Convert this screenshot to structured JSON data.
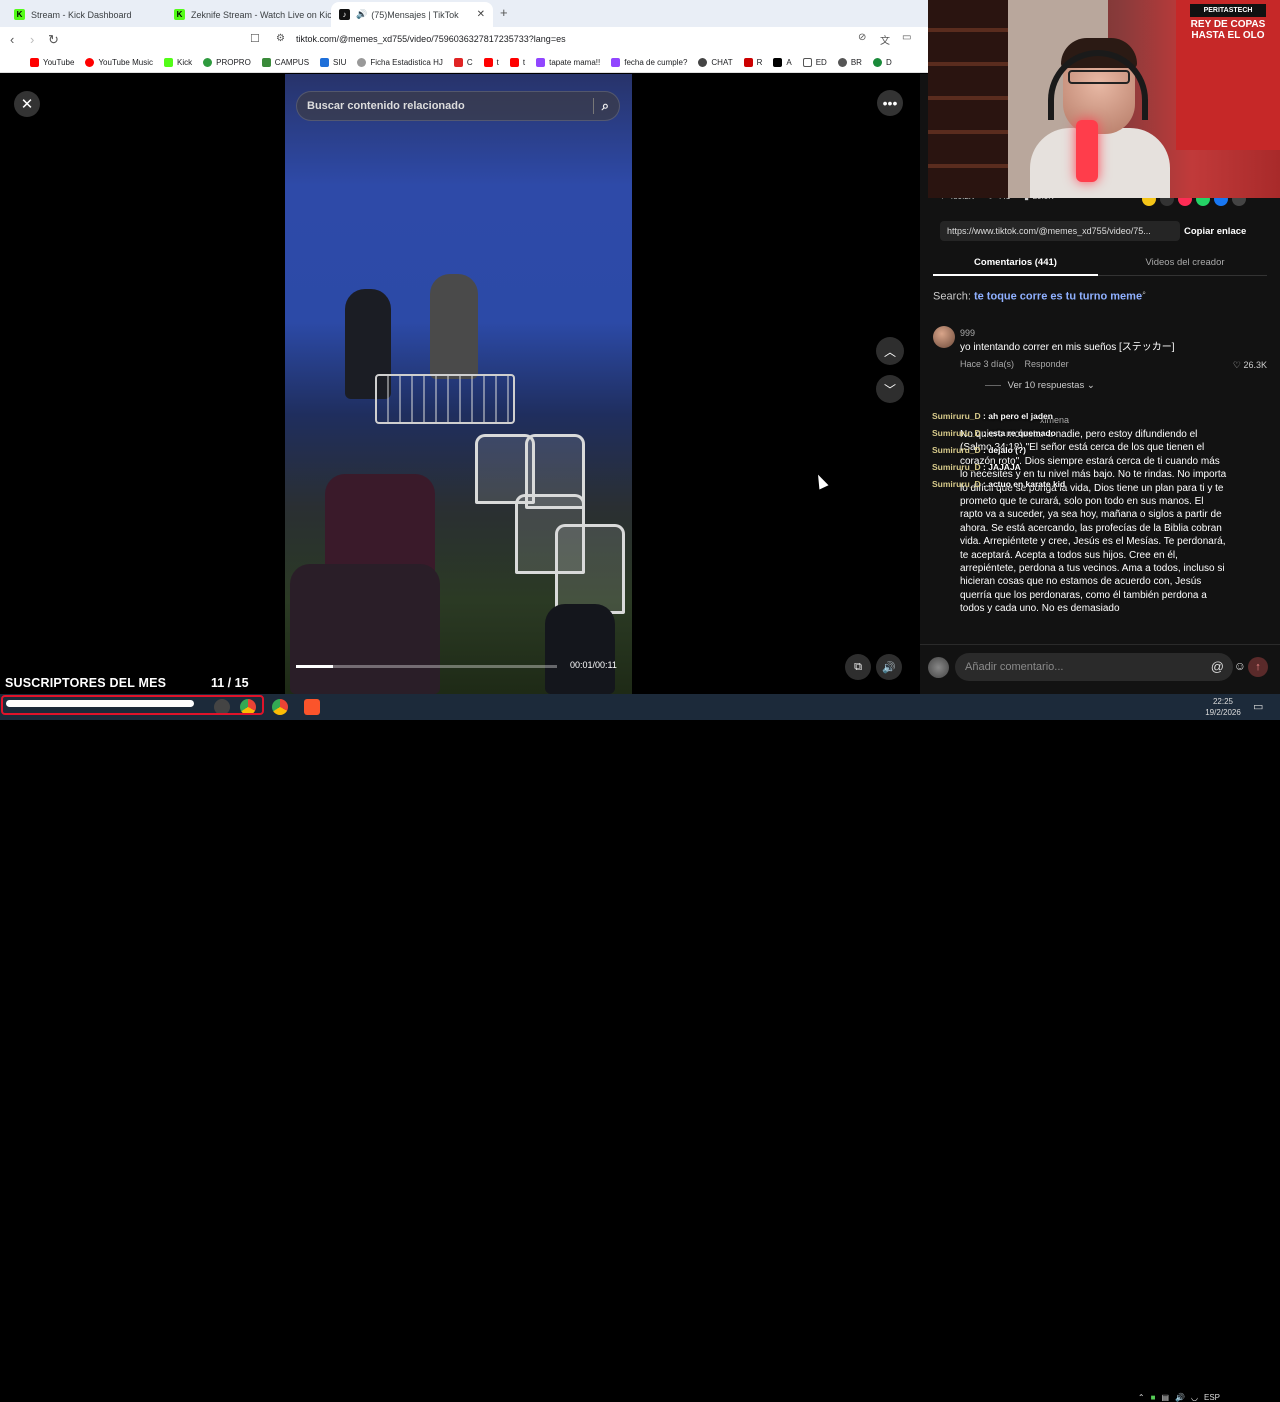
{
  "browser": {
    "tabs": [
      {
        "label": "Stream - Kick Dashboard",
        "icon": "kick-icon"
      },
      {
        "label": "Zeknife Stream - Watch Live on Kick",
        "icon": "kick-icon"
      },
      {
        "label": "(75)Mensajes | TikTok",
        "icon": "tiktok-icon",
        "active": true
      }
    ],
    "url": "tiktok.com/@memes_xd755/video/7596036327817235733?lang=es",
    "bookmarks": [
      "YouTube",
      "YouTube Music",
      "Kick",
      "PROPRO",
      "CAMPUS",
      "SIU",
      "Ficha Estadistica HJ",
      "C",
      "t",
      "t",
      "tapate mama!!",
      "fecha de cumple?",
      "CHAT",
      "R",
      "A",
      "ED",
      "BR",
      "D"
    ]
  },
  "player": {
    "search_placeholder": "Buscar contenido relacionado",
    "time": "00:01/00:11",
    "progress_fraction": 0.14
  },
  "overlay": {
    "subs_title": "SUSCRIPTORES DEL MES",
    "subs_count": "11  / 15"
  },
  "panel": {
    "stats": [
      "480.2K",
      "441",
      "29.9K"
    ],
    "link": "https://www.tiktok.com/@memes_xd755/video/75...",
    "copy_link": "Copiar enlace",
    "tab_comments": "Comentarios (441)",
    "tab_creator": "Videos del creador",
    "search_prefix": "Search: ",
    "search_term": "te toque corre es tu turno meme",
    "comment1": {
      "user": "999",
      "text": "yo intentando correr en mis sueños [ステッカー]",
      "meta": "Hace 3 día(s)",
      "reply": "Responder",
      "likes": "26.3K"
    },
    "view_replies": "Ver 10 respuestas",
    "comment2": {
      "user": "ximena",
      "text": "No quiero molestar a nadie, pero estoy difundiendo el (Salmo 34:18) \"El señor está cerca de los que tienen el corazón roto\". Dios siempre estará cerca de ti cuando más lo necesites y en tu nivel más bajo. No te rindas. No importa lo difícil que se ponga la vida, Dios tiene un plan para ti y te prometo que te curará, solo pon todo en sus manos. El rapto va a suceder, ya sea hoy, mañana o siglos a partir de ahora. Se está acercando, las profecías de la Biblia cobran vida. Arrepiéntete y cree, Jesús es el Mesías. Te perdonará, te aceptará. Acepta a todos sus hijos. Cree en él, arrepiéntete, perdona a tus vecinos. Ama a todos, incluso si hicieran cosas que no estamos de acuerdo con, Jesús querría que los perdonaras, como él también perdona a todos y cada uno. No es demasiado"
    },
    "comment_placeholder": "Añadir comentario..."
  },
  "chat": [
    {
      "user": "Sumiruru_D",
      "msg": "ah pero el jaden"
    },
    {
      "user": "Sumiruru_D",
      "msg": "esta re quemado"
    },
    {
      "user": "Sumiruru_D",
      "msg": "dejalo (?)"
    },
    {
      "user": "Sumiruru_D",
      "msg": "JAJAJA"
    },
    {
      "user": "Sumiruru_D",
      "msg": "actuo en karate kid"
    }
  ],
  "webcam": {
    "flag_top": "PERITASTECH",
    "flag_text": "REY DE COPAS HASTA EL OLO"
  },
  "taskbar": {
    "lang": "ESP",
    "time": "22:25",
    "date": "19/2/2026"
  }
}
